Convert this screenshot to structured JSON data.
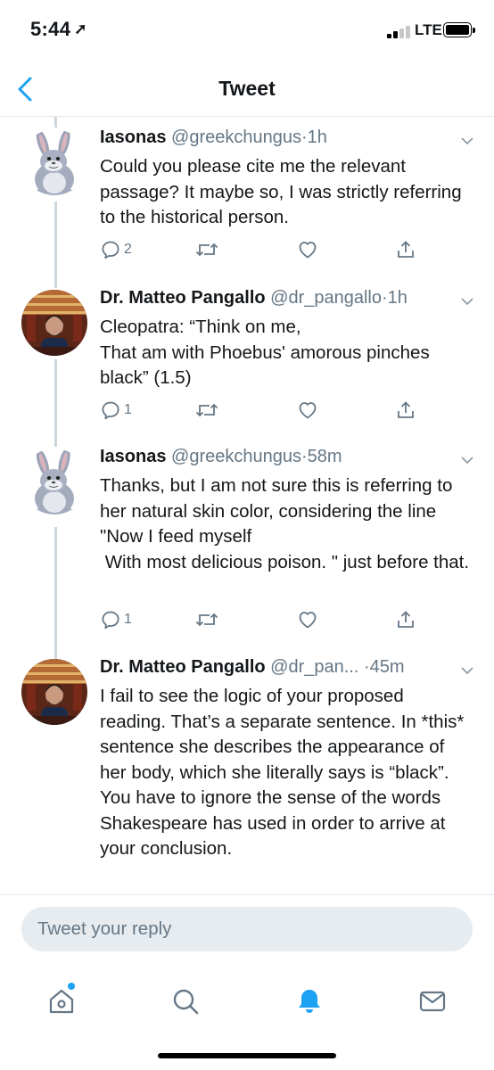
{
  "status_bar": {
    "time": "5:44",
    "network": "LTE",
    "battery_level": 0.95,
    "signal_bars_filled": 2,
    "signal_bars_total": 4
  },
  "nav": {
    "title": "Tweet",
    "back_icon": "chevron-left-icon"
  },
  "colors": {
    "accent": "#1da1f2",
    "text": "#14171a",
    "secondary": "#657786",
    "divider": "#e1e8ed",
    "input_bg": "#e6ecf0"
  },
  "tweets": [
    {
      "name": "Iasonas",
      "handle": "@greekchungus",
      "separator": "·",
      "time": "1h",
      "text": "Could you please cite me the relevant passage? It maybe so, I was strictly referring to the historical person.",
      "replies": "2",
      "avatar": "big-chungus-avatar"
    },
    {
      "name": "Dr. Matteo Pangallo",
      "handle": "@dr_pangallo",
      "separator": "·",
      "time": "1h",
      "text": "Cleopatra: “Think on me,\nThat am with Phoebus' amorous pinches black” (1.5)",
      "replies": "1",
      "avatar": "profile-photo-avatar"
    },
    {
      "name": "Iasonas",
      "handle": "@greekchungus",
      "separator": "·",
      "time": "58m",
      "text": "Thanks, but I am not sure this is referring to her natural skin color, considering the line \"Now I feed myself\n With most delicious poison. \" just before that.",
      "replies": "1",
      "avatar": "big-chungus-avatar"
    },
    {
      "name": "Dr. Matteo Pangallo",
      "handle": "@dr_pan...",
      "separator": "·",
      "time": "45m",
      "text": "I fail to see the logic of your proposed reading. That’s a separate sentence. In *this* sentence she describes the appearance of her body, which she literally says is “black”. You have to ignore the sense of the words Shakespeare has used in order to arrive at your conclusion.",
      "replies": "",
      "avatar": "profile-photo-avatar"
    }
  ],
  "reply": {
    "placeholder": "Tweet your reply"
  },
  "tabs": [
    {
      "name": "home",
      "icon": "home-icon",
      "has_notification_dot": true
    },
    {
      "name": "search",
      "icon": "search-icon"
    },
    {
      "name": "notifications",
      "icon": "bell-icon",
      "active": true
    },
    {
      "name": "messages",
      "icon": "mail-icon"
    }
  ]
}
